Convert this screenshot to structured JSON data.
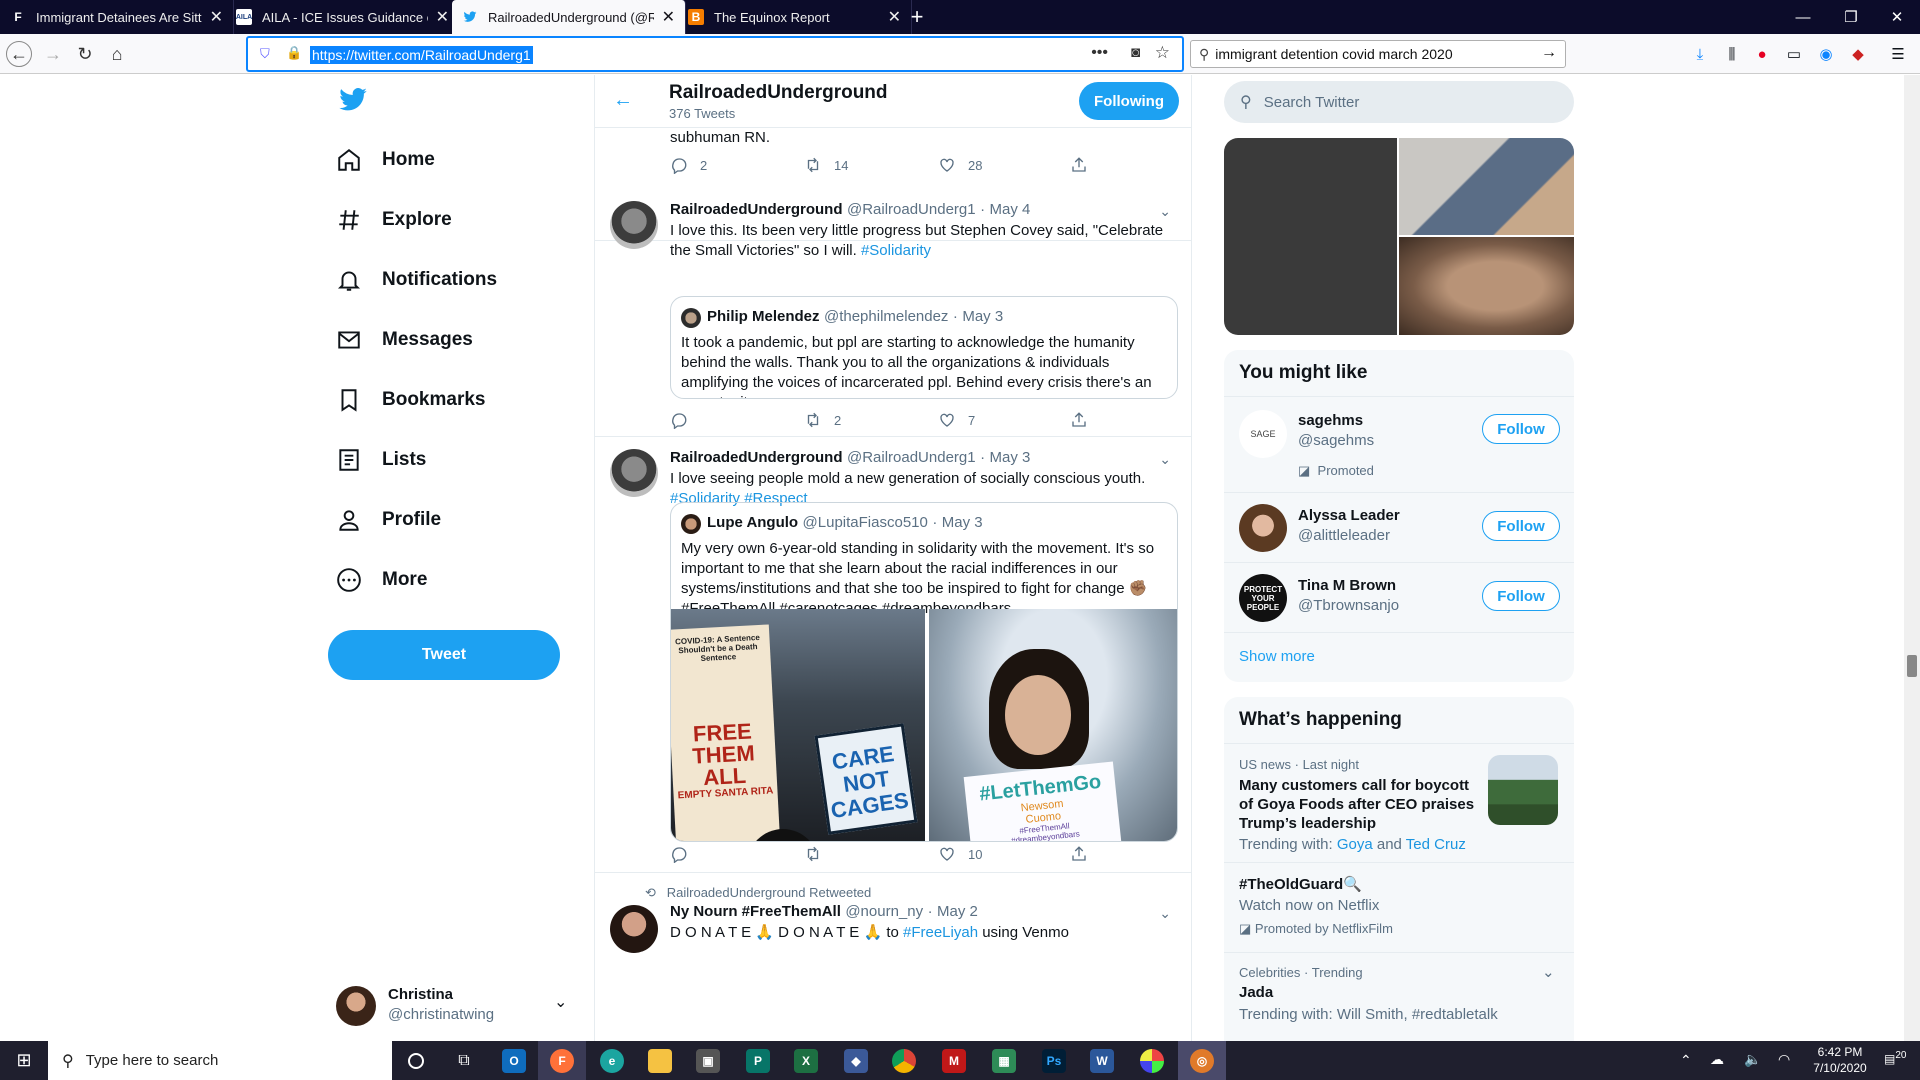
{
  "browser": {
    "tabs": [
      {
        "title": "Immigrant Detainees Are Sittin",
        "favicon": "F"
      },
      {
        "title": "AILA - ICE Issues Guidance on (",
        "favicon": "AILA"
      },
      {
        "title": "RailroadedUnderground (@Rai",
        "favicon": "twitter"
      },
      {
        "title": "The Equinox Report",
        "favicon": "blogger"
      }
    ],
    "url": "https://twitter.com/RailroadUnderg1",
    "search_query": "immigrant detention covid march 2020"
  },
  "sidebar": {
    "items": [
      {
        "label": "Home",
        "icon": "home-icon"
      },
      {
        "label": "Explore",
        "icon": "hashtag-icon"
      },
      {
        "label": "Notifications",
        "icon": "bell-icon"
      },
      {
        "label": "Messages",
        "icon": "mail-icon"
      },
      {
        "label": "Bookmarks",
        "icon": "bookmark-icon"
      },
      {
        "label": "Lists",
        "icon": "list-icon"
      },
      {
        "label": "Profile",
        "icon": "person-icon"
      },
      {
        "label": "More",
        "icon": "more-icon"
      }
    ],
    "tweet_button": "Tweet",
    "account": {
      "name": "Christina",
      "handle": "@christinatwing"
    }
  },
  "profile_header": {
    "name": "RailroadedUnderground",
    "tweet_count": "376 Tweets",
    "following_button": "Following"
  },
  "timeline": {
    "partial_tweet": {
      "text": "subhuman RN.",
      "replies": "2",
      "retweets": "14",
      "likes": "28"
    },
    "tweets": [
      {
        "name": "RailroadedUnderground",
        "handle": "@RailroadUnderg1",
        "date": "May 4",
        "text": "I love this. Its been very little progress but Stephen Covey said, \"Celebrate the Small Victories\" so I will.",
        "hashtags": "#Solidarity",
        "quote": {
          "name": "Philip Melendez",
          "handle": "@thephilmelendez",
          "date": "May 3",
          "text": "It took a pandemic, but ppl are starting to acknowledge the humanity behind the walls. Thank you to all the organizations & individuals amplifying the voices of incarcerated ppl. Behind every crisis there's an opportunity."
        },
        "replies": "",
        "retweets": "2",
        "likes": "7"
      },
      {
        "name": "RailroadedUnderground",
        "handle": "@RailroadUnderg1",
        "date": "May 3",
        "text": "I love seeing people mold a new generation of socially conscious youth.",
        "hashtags": "#Solidarity #Respect",
        "quote": {
          "name": "Lupe Angulo",
          "handle": "@LupitaFiasco510",
          "date": "May 3",
          "text": "My very own 6-year-old standing in solidarity with the movement. It's so important to me that she learn about the racial indifferences in our systems/institutions and that she too be inspired to fight for change ✊🏽",
          "hashtags": "#FreeThemAll #carenotcages #dreambeyondbars",
          "image1_signs": [
            "COVID-19: A Sentence Shouldn't be a Death Sentence",
            "FREE THEM ALL",
            "EMPTY SANTA RITA",
            "CARE NOT CAGES"
          ],
          "image2_sign": [
            "#LetThemGo",
            "Newsom",
            "Cuomo",
            "#FreeThemAll",
            "#dreambeyondbars"
          ]
        },
        "replies": "",
        "retweets": "",
        "likes": "10"
      }
    ],
    "retweet": {
      "label": "RailroadedUnderground Retweeted",
      "name": "Ny Nourn #FreeThemAll",
      "handle": "@nourn_ny",
      "date": "May 2",
      "text": "D O N A T E 🙏 D O N A T E 🙏 to",
      "link": "#FreeLiyah",
      "text_after": "using Venmo"
    }
  },
  "right": {
    "search_placeholder": "Search Twitter",
    "who_to_follow": {
      "title": "You might like",
      "users": [
        {
          "name": "sagehms",
          "handle": "@sagehms",
          "promoted": "Promoted",
          "button": "Follow",
          "avatar_text": "SAGE"
        },
        {
          "name": "Alyssa Leader",
          "handle": "@alittleleader",
          "button": "Follow"
        },
        {
          "name": "Tina M Brown",
          "handle": "@Tbrownsanjo",
          "button": "Follow",
          "avatar_text": "PROTECT YOUR PEOPLE"
        }
      ],
      "show_more": "Show more"
    },
    "happening": {
      "title": "What’s happening",
      "items": [
        {
          "meta": "US news · Last night",
          "headline": "Many customers call for boycott of Goya Foods after CEO praises Trump’s leadership",
          "trending_prefix": "Trending with:",
          "link1": "Goya",
          "and": "and",
          "link2": "Ted Cruz"
        },
        {
          "headline": "#TheOldGuard🔍",
          "sub": "Watch now on Netflix",
          "promoted": "Promoted by NetflixFilm"
        },
        {
          "meta": "Celebrities · Trending",
          "headline": "Jada",
          "sub": "Trending with: Will Smith, #redtabletalk"
        }
      ]
    }
  },
  "taskbar": {
    "search_placeholder": "Type here to search",
    "time": "6:42 PM",
    "date": "7/10/2020",
    "notification_count": "20"
  }
}
